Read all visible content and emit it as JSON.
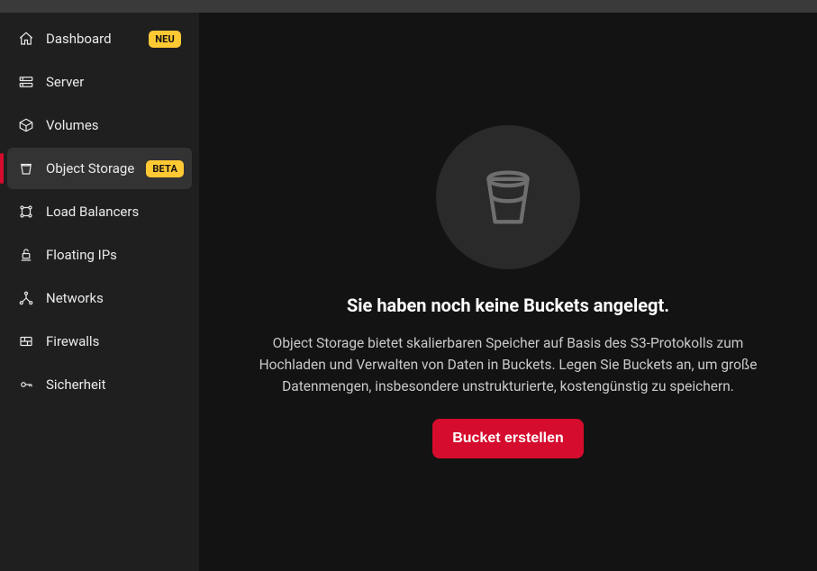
{
  "sidebar": {
    "items": [
      {
        "icon": "home",
        "label": "Dashboard",
        "badge": "NEU",
        "active": false
      },
      {
        "icon": "server",
        "label": "Server",
        "badge": null,
        "active": false
      },
      {
        "icon": "cube",
        "label": "Volumes",
        "badge": null,
        "active": false
      },
      {
        "icon": "bucket",
        "label": "Object Storage",
        "badge": "BETA",
        "active": true
      },
      {
        "icon": "lb",
        "label": "Load Balancers",
        "badge": null,
        "active": false
      },
      {
        "icon": "floating",
        "label": "Floating IPs",
        "badge": null,
        "active": false
      },
      {
        "icon": "network",
        "label": "Networks",
        "badge": null,
        "active": false
      },
      {
        "icon": "firewall",
        "label": "Firewalls",
        "badge": null,
        "active": false
      },
      {
        "icon": "key",
        "label": "Sicherheit",
        "badge": null,
        "active": false
      }
    ]
  },
  "empty_state": {
    "title": "Sie haben noch keine Buckets angelegt.",
    "description": "Object Storage bietet skalierbaren Speicher auf Basis des S3-Protokolls zum Hochladen und Verwalten von Daten in Buckets. Legen Sie Buckets an, um große Datenmengen, insbesondere unstrukturierte, kostengünstig zu speichern.",
    "cta": "Bucket erstellen"
  },
  "colors": {
    "accent": "#d50c2d",
    "badge_bg": "#ffc933"
  }
}
